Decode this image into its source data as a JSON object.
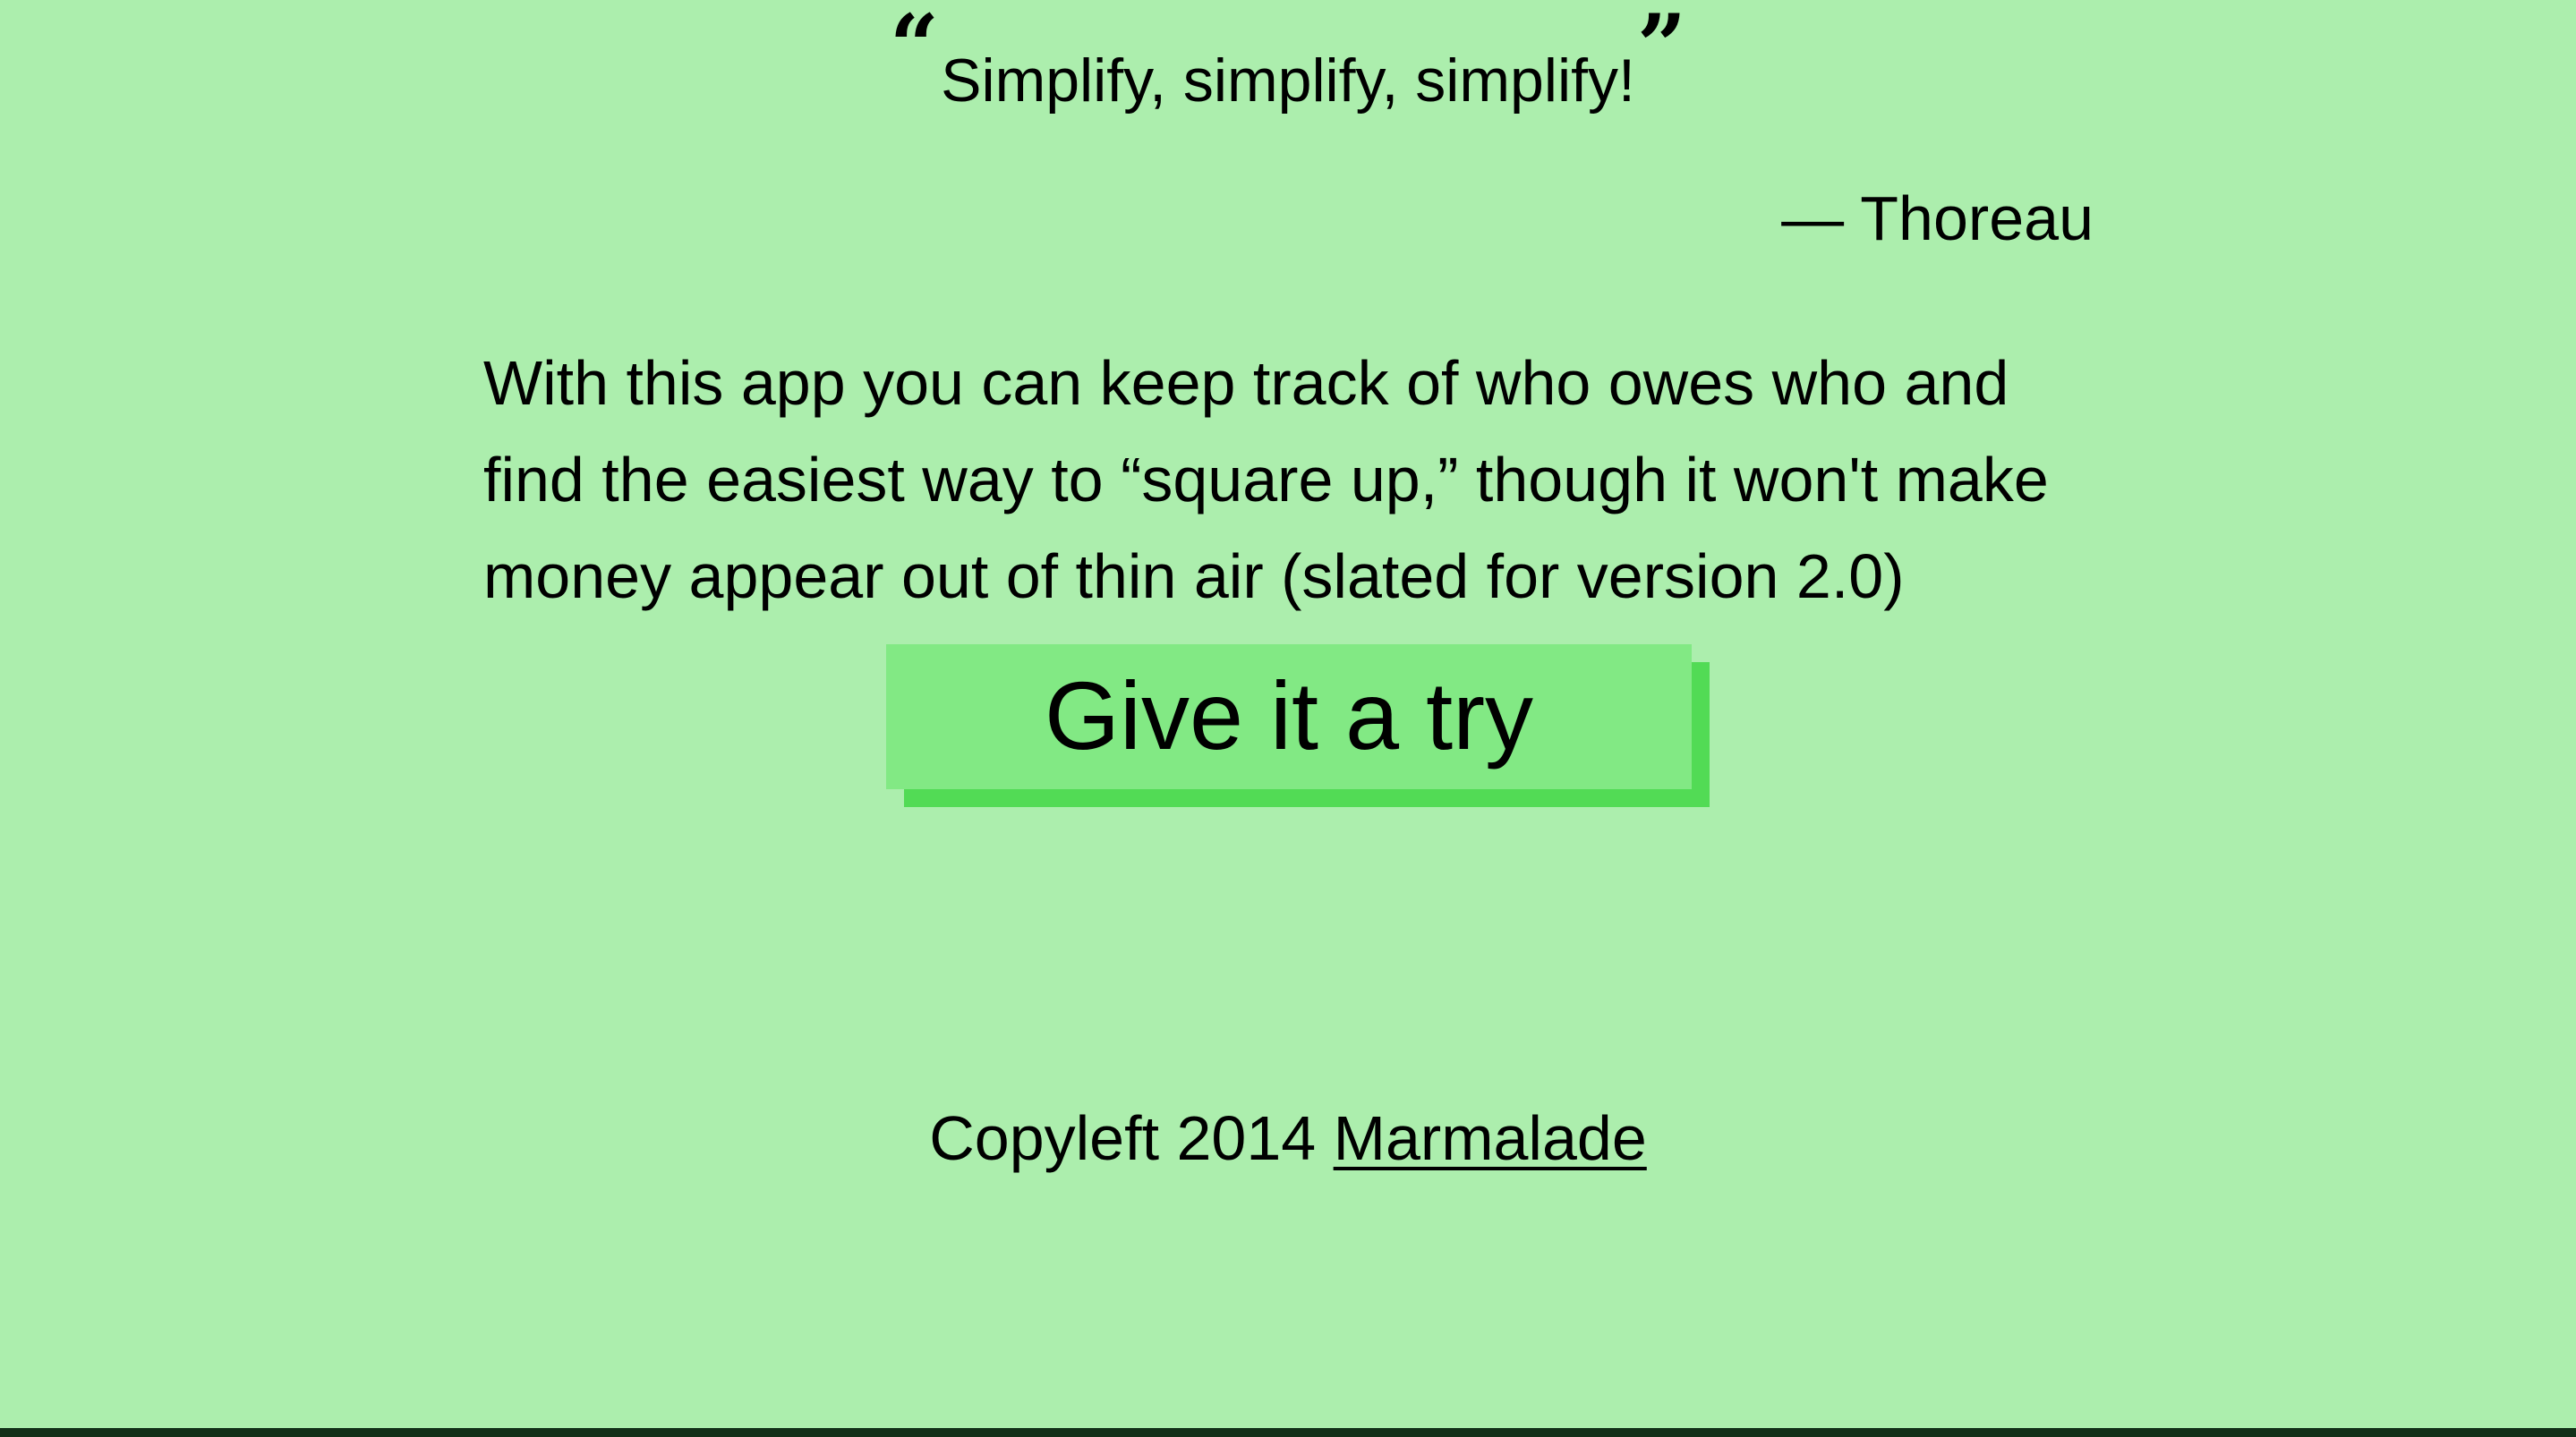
{
  "quote": {
    "open_mark": "“",
    "text": "Simplify, simplify, simplify!",
    "close_mark": "”",
    "attribution": "— Thoreau"
  },
  "intro": {
    "text": "With this app you can keep track of who owes who and find the easiest way to “square up,” though it won't make money appear out of thin air (slated for version 2.0)"
  },
  "cta": {
    "label": "Give it a try"
  },
  "footer": {
    "copyright_text": "Copyleft 2014",
    "link_label": "Marmalade"
  },
  "colors": {
    "background": "#aceead",
    "button": "#82e984",
    "button_shadow": "#52db55",
    "bottom_bar": "#123018"
  }
}
